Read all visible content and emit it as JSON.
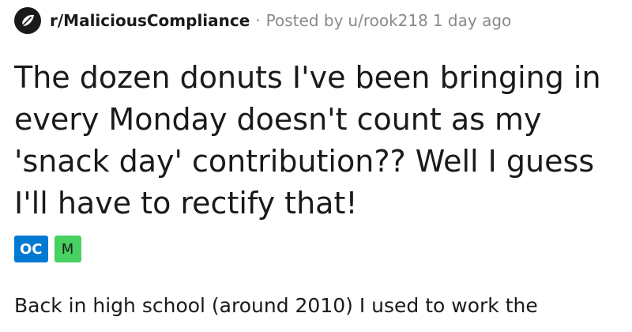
{
  "post": {
    "subreddit": "r/MaliciousCompliance",
    "separator": "·",
    "posted_by_label": "Posted by",
    "author": "u/rook218",
    "time_ago": "1 day ago",
    "subreddit_icon": "subreddit-logo-icon",
    "title_lines": [
      "The dozen donuts I've been bringing in",
      "every Monday doesn't count as my",
      "'snack day' contribution?? Well I guess",
      "I'll have to rectify that!"
    ],
    "flairs": [
      {
        "label": "OC",
        "color": "#0079d3",
        "text_color": "#ffffff"
      },
      {
        "label": "M",
        "color": "#46d160",
        "text_color": "#1a1a1b"
      }
    ],
    "body_preview": "Back in high school (around 2010) I used to work the"
  }
}
